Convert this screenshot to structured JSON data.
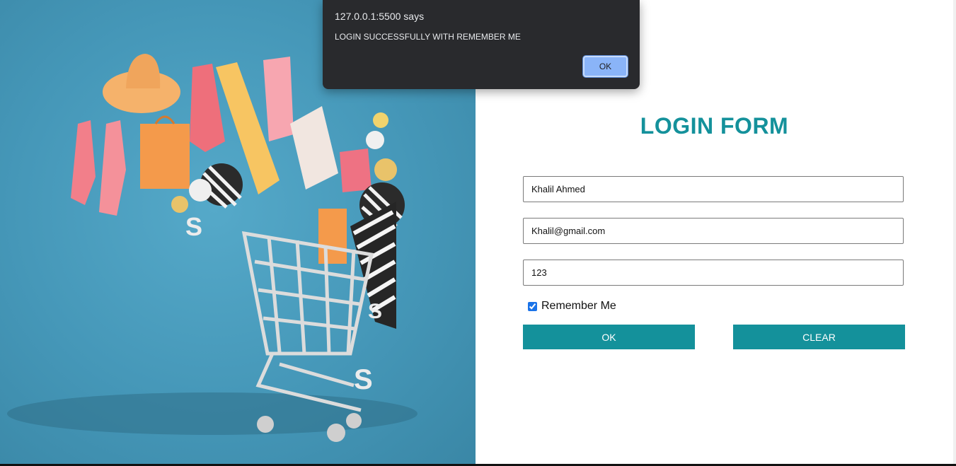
{
  "alert": {
    "origin": "127.0.0.1:5500 says",
    "message": "LOGIN SUCCESSFULLY WITH REMEMBER ME",
    "ok_label": "OK"
  },
  "form": {
    "title": "LOGIN FORM",
    "name_value": "Khalil Ahmed",
    "email_value": "Khalil@gmail.com",
    "password_value": "123",
    "remember_label": "Remember Me",
    "remember_checked": true,
    "ok_label": "OK",
    "clear_label": "CLEAR"
  },
  "colors": {
    "accent": "#14919b",
    "hero_background": "#4597b8",
    "dialog_background": "#292a2d",
    "dialog_button": "#8ab4f8"
  },
  "hero": {
    "icon": "shopping-cart-illustration"
  }
}
